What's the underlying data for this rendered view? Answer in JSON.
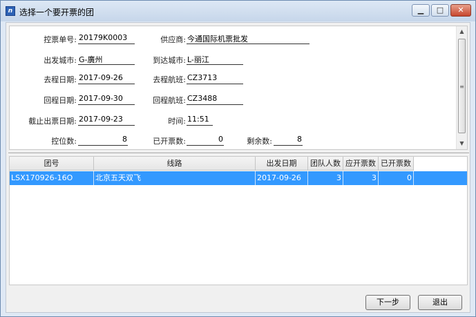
{
  "window": {
    "title": "选择一个要开票的团",
    "icon": "app-icon"
  },
  "window_controls": {
    "minimize_icon": "minimize-icon",
    "maximize_icon": "maximize-icon",
    "close_icon": "close-icon"
  },
  "form": {
    "ticket_no": {
      "label": "控票单号:",
      "value": "20179K0003"
    },
    "supplier": {
      "label": "供应商:",
      "value": "今通国际机票批发"
    },
    "depart_city": {
      "label": "出发城市:",
      "value": "G-廣州"
    },
    "arrive_city": {
      "label": "到达城市:",
      "value": "L-丽江"
    },
    "outbound_date": {
      "label": "去程日期:",
      "value": "2017-09-26"
    },
    "outbound_flight": {
      "label": "去程航班:",
      "value": "CZ3713"
    },
    "return_date": {
      "label": "回程日期:",
      "value": "2017-09-30"
    },
    "return_flight": {
      "label": "回程航班:",
      "value": "CZ3488"
    },
    "deadline_date": {
      "label": "截止出票日期:",
      "value": "2017-09-23"
    },
    "time": {
      "label": "时间:",
      "value": "11:51"
    },
    "reserved_count": {
      "label": "控位数:",
      "value": "8"
    },
    "issued_count": {
      "label": "已开票数:",
      "value": "0"
    },
    "remaining_count": {
      "label": "剩余数:",
      "value": "8"
    }
  },
  "table": {
    "columns": [
      "团号",
      "线路",
      "出发日期",
      "团队人数",
      "应开票数",
      "已开票数"
    ],
    "rows": [
      {
        "group_no": "LSX170926-16O",
        "route": "北京五天双飞",
        "depart_date": "2017-09-26",
        "team_size": "3",
        "to_issue": "3",
        "issued": "0"
      }
    ]
  },
  "buttons": {
    "next": "下一步",
    "exit": "退出"
  }
}
